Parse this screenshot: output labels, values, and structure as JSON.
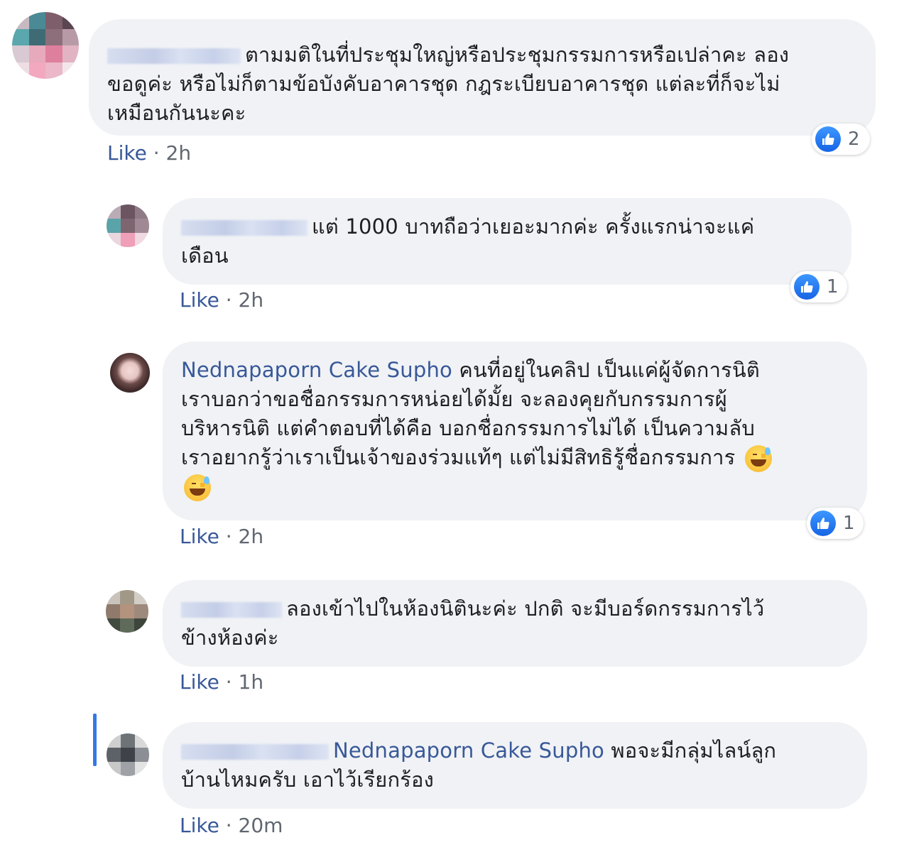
{
  "comments": [
    {
      "author": "",
      "text": "ตามมติในที่ประชุมใหญ่หรือประชุมกรรมการหรือเปล่าคะ ลองขอดูค่ะ หรือไม่ก็ตามข้อบังคับอาคารชุด กฎระเบียบอาคารชุด แต่ละที่ก็จะไม่เหมือนกันนะคะ",
      "line1": "ตามมติในที่ประชุมใหญ่หรือประชุมกรรมการหรือเปล่าคะ ลอง",
      "line2": "ขอดูค่ะ หรือไม่ก็ตามข้อบังคับอาคารชุด กฎระเบียบอาคารชุด แต่ละที่ก็จะไม่",
      "line3": "เหมือนกันนะคะ",
      "like_label": "Like",
      "time": "2h",
      "reactions": "2"
    },
    {
      "author": "",
      "line1": "แต่ 1000 บาทถือว่าเยอะมากค่ะ ครั้งแรกน่าจะแค่",
      "line2": "เดือน",
      "like_label": "Like",
      "time": "2h",
      "reactions": "1"
    },
    {
      "author": "Nednapaporn Cake Supho",
      "line1": "คนที่อยู่ในคลิป เป็นแค่ผู้จัดการนิติ",
      "line2": "เราบอกว่าขอชื่อกรรมการหน่อยได้มั้ย จะลองคุยกับกรรมการผู้",
      "line3": "บริหารนิติ แต่คำตอบที่ได้คือ บอกชื่อกรรมการไม่ได้ เป็นความลับ",
      "line4": "เราอยากรู้ว่าเราเป็นเจ้าของร่วมแท้ๆ แต่ไม่มีสิทธิรู้ชื่อกรรมการ",
      "like_label": "Like",
      "time": "2h",
      "reactions": "1"
    },
    {
      "author": "",
      "line1": "ลองเข้าไปในห้องนิตินะค่ะ ปกติ จะมีบอร์ดกรรมการไว้",
      "line2": "ข้างห้องค่ะ",
      "like_label": "Like",
      "time": "1h"
    },
    {
      "author": "",
      "mention": "Nednapaporn Cake Supho",
      "line1": "พอจะมีกลุ่มไลน์ลูก",
      "line2": "บ้านไหมครับ เอาไว้เรียกร้อง",
      "like_label": "Like",
      "time": "20m"
    }
  ],
  "colors": {
    "link": "#385898",
    "bubble": "#f0f2f5",
    "meta": "#606770",
    "thread_line": "#3578e5"
  },
  "icons": [
    "like-thumb-icon",
    "sweat-smile-emoji-icon"
  ]
}
